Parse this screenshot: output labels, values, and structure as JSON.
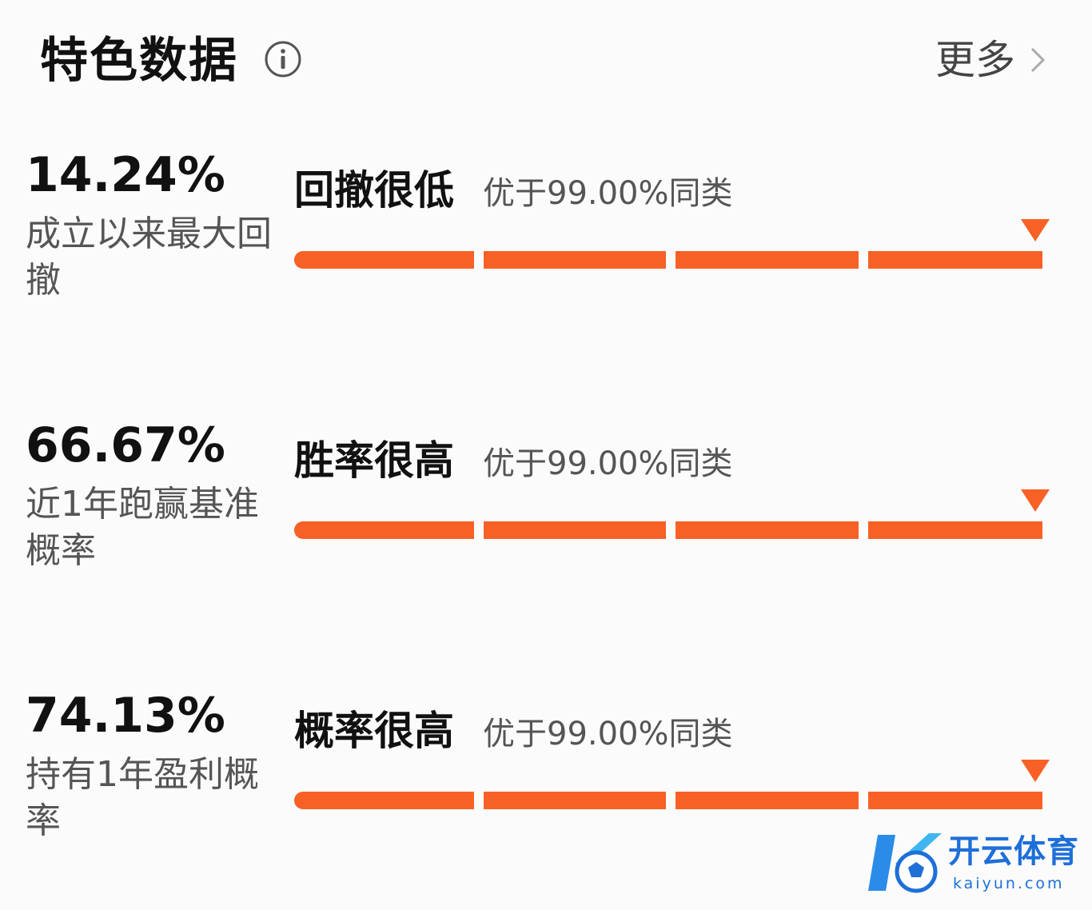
{
  "header": {
    "title": "特色数据",
    "more_label": "更多"
  },
  "metrics": [
    {
      "value": "14.24%",
      "description": "成立以来最大回撤",
      "rating": "回撤很低",
      "compare": "优于99.00%同类",
      "percentile": 99.0
    },
    {
      "value": "66.67%",
      "description": "近1年跑赢基准概率",
      "rating": "胜率很高",
      "compare": "优于99.00%同类",
      "percentile": 99.0
    },
    {
      "value": "74.13%",
      "description": "持有1年盈利概率",
      "rating": "概率很高",
      "compare": "优于99.00%同类",
      "percentile": 99.0
    }
  ],
  "watermark": {
    "brand": "开云体育",
    "domain": "kaiyun.com"
  },
  "colors": {
    "accent": "#f86125",
    "title": "#111111",
    "secondary_text": "#555555",
    "watermark": "#1e6fd8"
  },
  "icons": {
    "info": "info-icon",
    "more": "chevron-right-icon",
    "marker": "triangle-down-icon"
  }
}
